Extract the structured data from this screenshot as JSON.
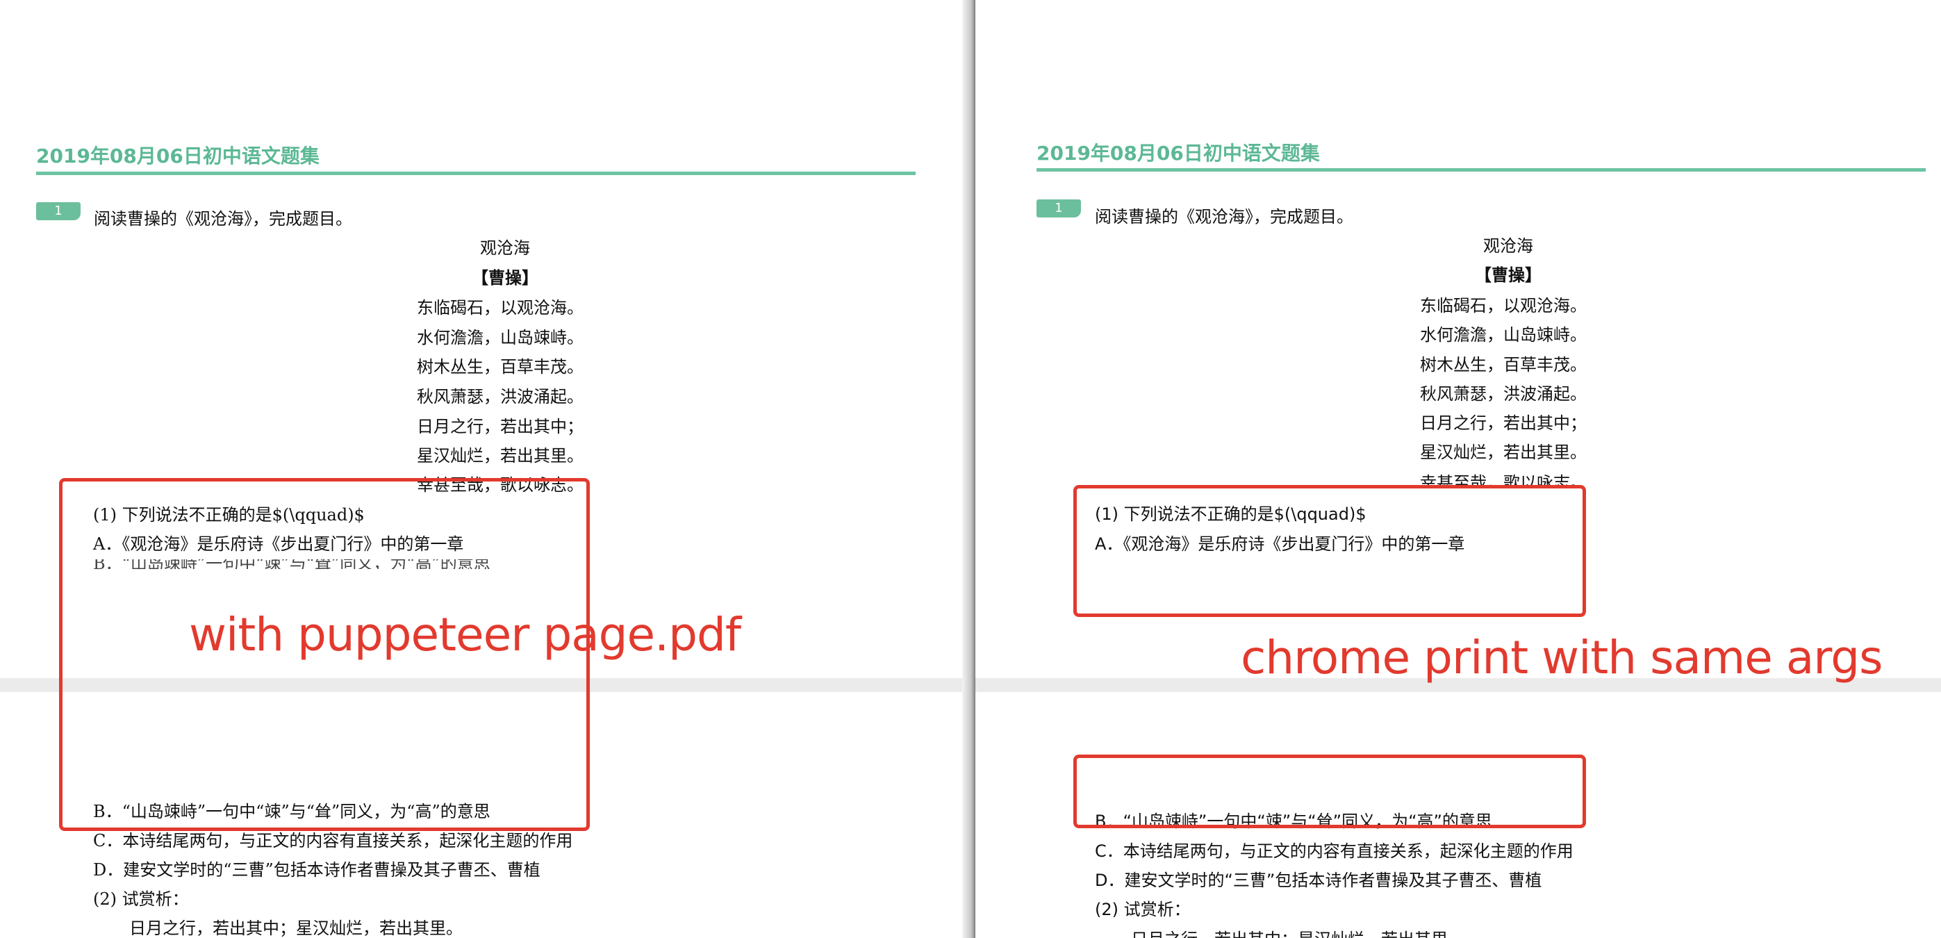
{
  "left": {
    "header_title": "2019年08月06日初中语文题集",
    "question_number": "1",
    "prompt": "阅读曹操的《观沧海》，完成题目。",
    "poem_title": "观沧海",
    "poem_author": "【曹操】",
    "poem_lines": [
      "东临碣石，以观沧海。",
      "水何澹澹，山岛竦峙。",
      "树木丛生，百草丰茂。",
      "秋风萧瑟，洪波涌起。",
      "日月之行，若出其中；",
      "星汉灿烂，若出其里。",
      "幸甚至哉，歌以咏志。"
    ],
    "sub_q1": "(1) 下列说法不正确的是$(\\qquad)$",
    "option_a": "A．《观沧海》是乐府诗《步出夏门行》中的第一章",
    "option_b": "B．“山岛竦峙”一句中“竦”与“耸”同义，为“高”的意思",
    "option_c": "C．本诗结尾两句，与正文的内容有直接关系，起深化主题的作用",
    "option_d": "D．建安文学时的“三曹”包括本诗作者曹操及其子曹丕、曹植",
    "sub_q2": "(2) 试赏析：",
    "quote": "日月之行，若出其中；星汉灿烂，若出其里。",
    "annotation": "with puppeteer page.pdf"
  },
  "right": {
    "header_title": "2019年08月06日初中语文题集",
    "question_number": "1",
    "prompt": "阅读曹操的《观沧海》，完成题目。",
    "poem_title": "观沧海",
    "poem_author": "【曹操】",
    "poem_lines": [
      "东临碣石，以观沧海。",
      "水何澹澹，山岛竦峙。",
      "树木丛生，百草丰茂。",
      "秋风萧瑟，洪波涌起。",
      "日月之行，若出其中；",
      "星汉灿烂，若出其里。",
      "幸甚至哉，歌以咏志。"
    ],
    "sub_q1": "(1) 下列说法不正确的是$(\\qquad)$",
    "option_a": "A．《观沧海》是乐府诗《步出夏门行》中的第一章",
    "option_b": "B．“山岛竦峙”一句中“竦”与“耸”同义，为“高”的意思",
    "option_c": "C．本诗结尾两句，与正文的内容有直接关系，起深化主题的作用",
    "option_d": "D．建安文学时的“三曹”包括本诗作者曹操及其子曹丕、曹植",
    "sub_q2": "(2) 试赏析：",
    "quote": "日月之行，若出其中；星汉灿烂，若出其里。",
    "annotation": "chrome print with same args"
  },
  "colors": {
    "accent_green": "#5cb895",
    "annotation_red": "#e23a2e",
    "page_gap": "#ebebeb"
  }
}
